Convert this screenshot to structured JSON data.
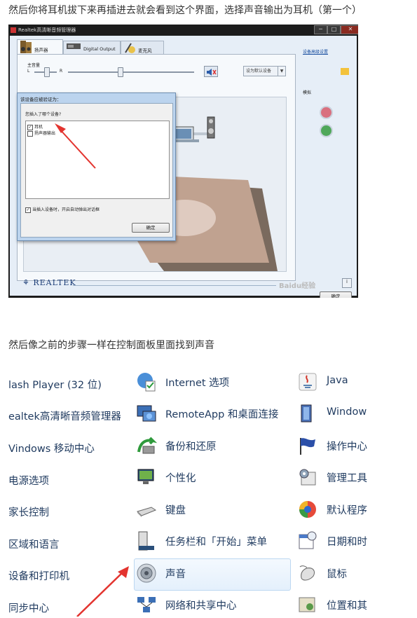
{
  "captions": {
    "top": "然后你将耳机拔下来再插进去就会看到这个界面，选择声音输出为耳机（第一个）",
    "middle": "然后像之前的步骤一样在控制面板里面找到声音"
  },
  "realtek": {
    "window_title": "Realtek高清晰音频管理器",
    "window_buttons": [
      "─",
      "□",
      "✕"
    ],
    "tabs": [
      "扬声器",
      "Digital Output",
      "麦克风"
    ],
    "main_volume_label": "主音量",
    "left_label": "L",
    "right_label": "R",
    "default_device": "设为默认设备",
    "device_advanced": "设备高级设置",
    "analog_label": "模拟",
    "logo_text": "REALTEK",
    "ok_button": "确定",
    "watermark": "Baidu经验",
    "dialog": {
      "title": "该设备应被验证为：",
      "question": "您插入了哪个设备?",
      "options": [
        {
          "label": "耳机",
          "checked": true
        },
        {
          "label": "扬声器输出",
          "checked": false
        }
      ],
      "autopopup_label": "当插入设备时，开启自动弹出对话框",
      "autopopup_checked": true,
      "ok": "确定"
    },
    "colors": {
      "arrow": "#e3342f",
      "jack_pink": "#d9707f",
      "jack_green": "#4fa85a"
    }
  },
  "control_panel": {
    "rows": [
      [
        "lash Player (32 位)",
        "Internet 选项",
        "Java"
      ],
      [
        "ealtek高清晰音频管理器",
        "RemoteApp 和桌面连接",
        "Window"
      ],
      [
        "Vindows 移动中心",
        "备份和还原",
        "操作中心"
      ],
      [
        "电源选项",
        "个性化",
        "管理工具"
      ],
      [
        "家长控制",
        "键盘",
        "默认程序"
      ],
      [
        "区域和语言",
        "任务栏和「开始」菜单",
        "日期和时"
      ],
      [
        "设备和打印机",
        "声音",
        "鼠标"
      ],
      [
        "同步中心",
        "网络和共享中心",
        "位置和其"
      ]
    ],
    "highlighted": "声音"
  }
}
